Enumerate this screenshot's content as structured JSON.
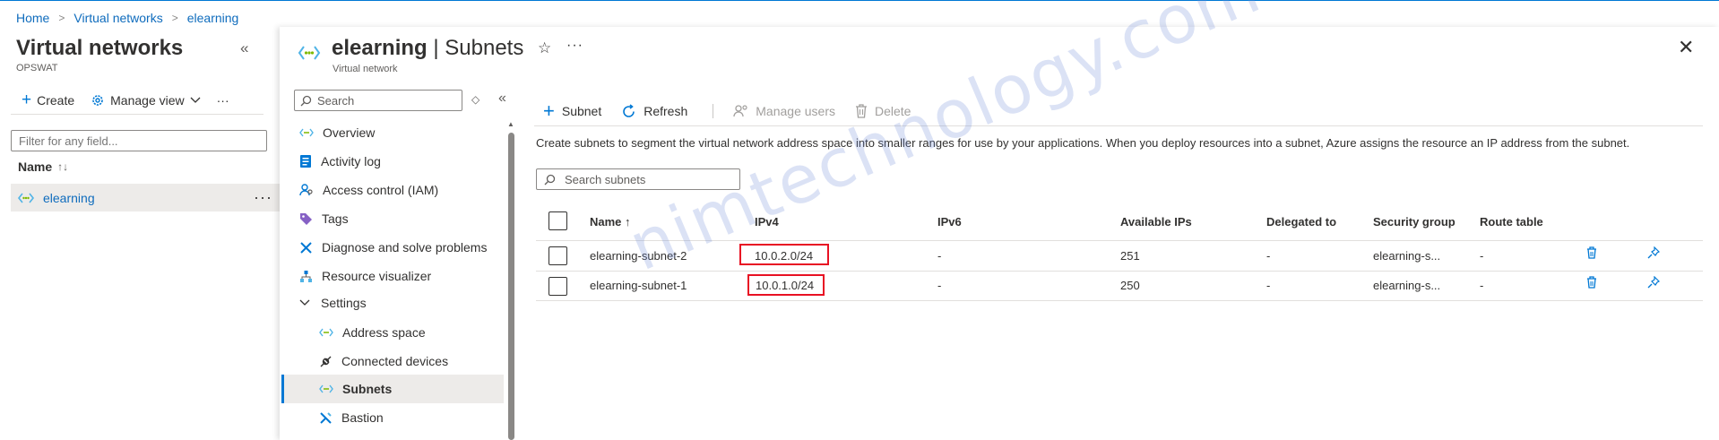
{
  "breadcrumb": [
    "Home",
    "Virtual networks",
    "elearning"
  ],
  "left_blade": {
    "title": "Virtual networks",
    "subtitle": "OPSWAT",
    "toolbar": {
      "create": "Create",
      "manage_view": "Manage view",
      "more": "···"
    },
    "filter_placeholder": "Filter for any field...",
    "column_name": "Name",
    "sort_indicator": "↑↓",
    "items": [
      {
        "name": "elearning"
      }
    ],
    "row_more": "···"
  },
  "resource": {
    "name": "elearning",
    "title_sep": " | ",
    "section": "Subnets",
    "type": "Virtual network",
    "more": "···"
  },
  "nav": {
    "search_placeholder": "Search",
    "items": [
      {
        "label": "Overview",
        "icon": "network-icon"
      },
      {
        "label": "Activity log",
        "icon": "activity-log-icon"
      },
      {
        "label": "Access control (IAM)",
        "icon": "iam-icon"
      },
      {
        "label": "Tags",
        "icon": "tag-icon"
      },
      {
        "label": "Diagnose and solve problems",
        "icon": "wrench-icon"
      },
      {
        "label": "Resource visualizer",
        "icon": "visualizer-icon"
      },
      {
        "label": "Settings",
        "icon": "chevron-down-icon"
      },
      {
        "label": "Address space",
        "icon": "network-icon"
      },
      {
        "label": "Connected devices",
        "icon": "plug-icon"
      },
      {
        "label": "Subnets",
        "icon": "network-icon"
      },
      {
        "label": "Bastion",
        "icon": "bastion-icon"
      }
    ],
    "selected": "Subnets"
  },
  "toolbar": {
    "add_subnet": "Subnet",
    "refresh": "Refresh",
    "manage_users": "Manage users",
    "delete": "Delete"
  },
  "description": "Create subnets to segment the virtual network address space into smaller ranges for use by your applications. When you deploy resources into a subnet, Azure assigns the resource an IP address from the subnet.",
  "subnet_search_placeholder": "Search subnets",
  "table": {
    "columns": [
      "Name ↑",
      "IPv4",
      "IPv6",
      "Available IPs",
      "Delegated to",
      "Security group",
      "Route table"
    ],
    "rows": [
      {
        "name": "elearning-subnet-2",
        "ipv4": "10.0.2.0/24",
        "ipv6": "-",
        "available_ips": "251",
        "delegated_to": "-",
        "security_group": "elearning-s...",
        "route_table": "-"
      },
      {
        "name": "elearning-subnet-1",
        "ipv4": "10.0.1.0/24",
        "ipv6": "-",
        "available_ips": "250",
        "delegated_to": "-",
        "security_group": "elearning-s...",
        "route_table": "-"
      }
    ]
  },
  "watermark": "nimtechnology.com",
  "colors": {
    "accent": "#0078d4",
    "link": "#0f6cbd",
    "highlight": "#e81123",
    "selected_bg": "#edebe9"
  }
}
